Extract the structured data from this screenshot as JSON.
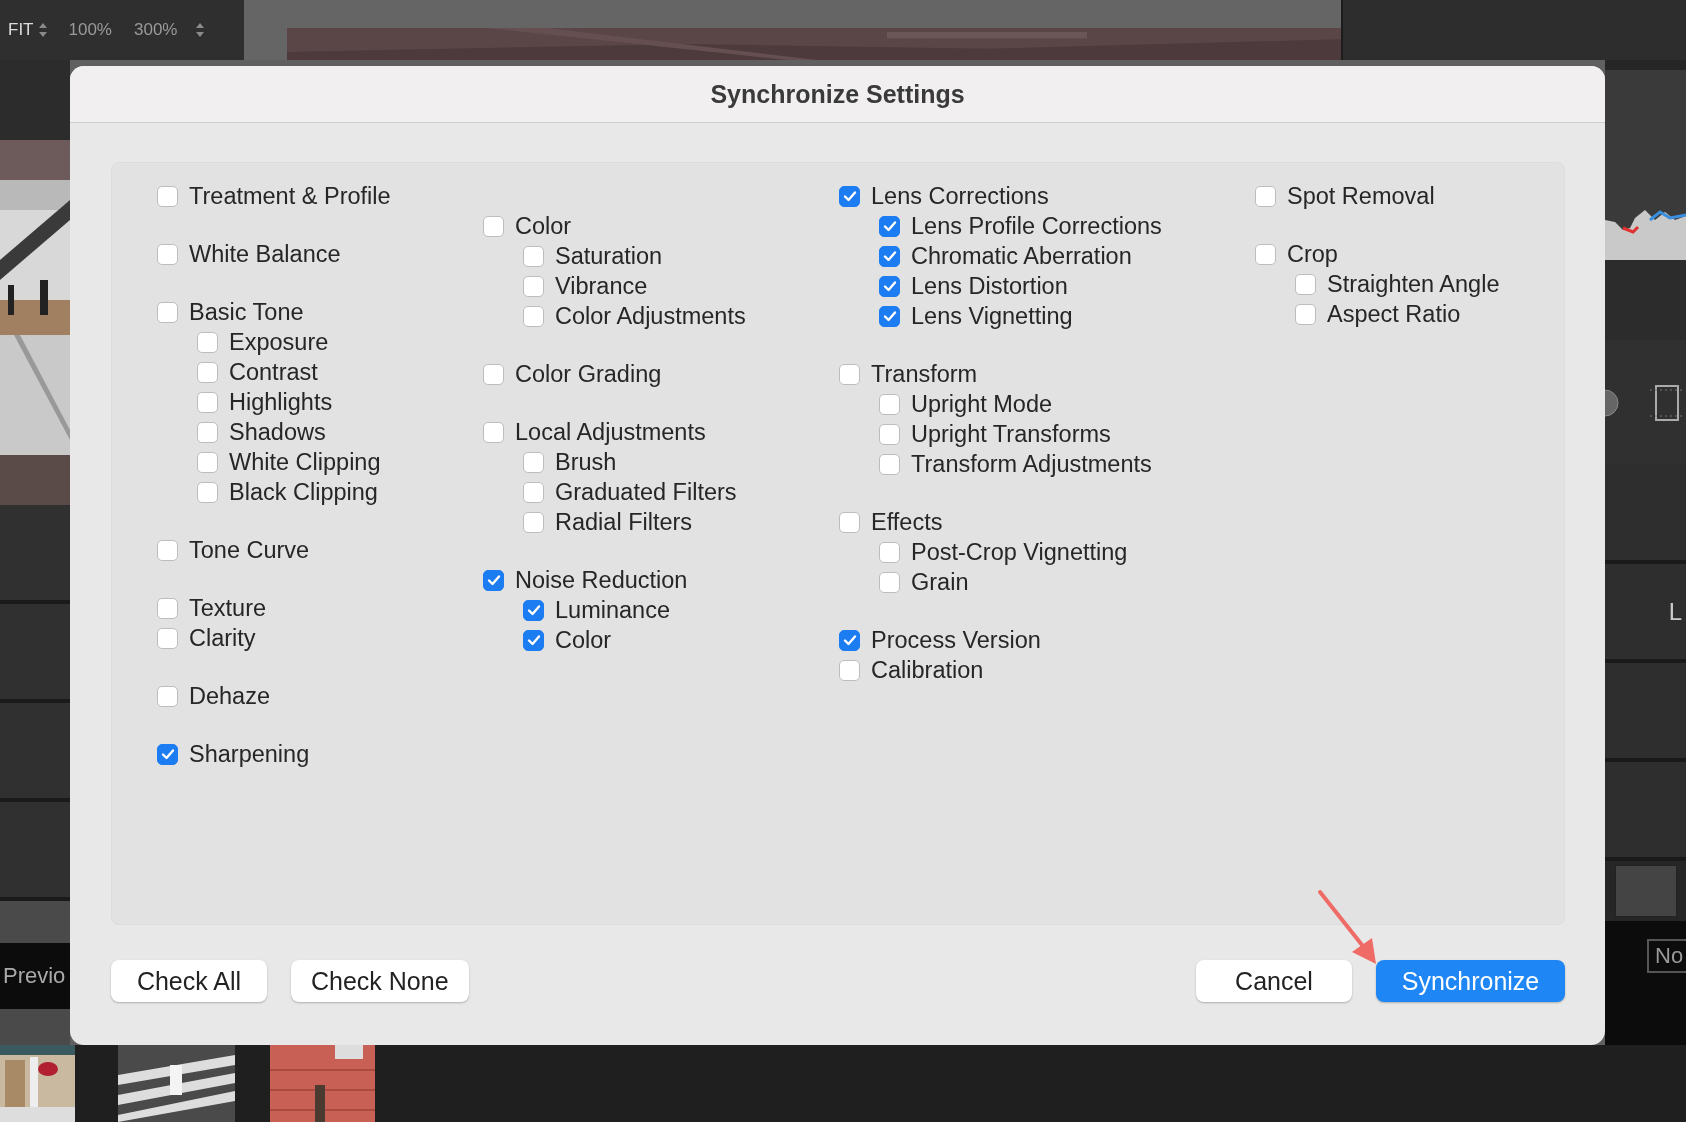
{
  "toolbar": {
    "zoom_options": [
      {
        "label": "FIT",
        "stepper": true
      },
      {
        "label": "100%",
        "stepper": false
      },
      {
        "label": "300%",
        "stepper": true
      }
    ]
  },
  "left_panel": {
    "button_label": "Previo"
  },
  "right_panel": {
    "panel_label": "L",
    "field_value": "No"
  },
  "dialog": {
    "title": "Synchronize Settings",
    "columns": [
      {
        "sections": [
          {
            "items": [
              {
                "label": "Treatment & Profile",
                "checked": false
              }
            ]
          },
          {
            "items": [
              {
                "label": "White Balance",
                "checked": false
              }
            ]
          },
          {
            "items": [
              {
                "label": "Basic Tone",
                "checked": false,
                "children": [
                  {
                    "label": "Exposure",
                    "checked": false
                  },
                  {
                    "label": "Contrast",
                    "checked": false
                  },
                  {
                    "label": "Highlights",
                    "checked": false
                  },
                  {
                    "label": "Shadows",
                    "checked": false
                  },
                  {
                    "label": "White Clipping",
                    "checked": false
                  },
                  {
                    "label": "Black Clipping",
                    "checked": false
                  }
                ]
              }
            ]
          },
          {
            "items": [
              {
                "label": "Tone Curve",
                "checked": false
              }
            ]
          },
          {
            "items": [
              {
                "label": "Texture",
                "checked": false
              },
              {
                "label": "Clarity",
                "checked": false
              }
            ]
          },
          {
            "items": [
              {
                "label": "Dehaze",
                "checked": false
              }
            ]
          },
          {
            "items": [
              {
                "label": "Sharpening",
                "checked": true
              }
            ]
          }
        ]
      },
      {
        "sections": [
          {
            "items": [
              {
                "label": "Color",
                "checked": false,
                "children": [
                  {
                    "label": "Saturation",
                    "checked": false
                  },
                  {
                    "label": "Vibrance",
                    "checked": false
                  },
                  {
                    "label": "Color Adjustments",
                    "checked": false
                  }
                ]
              }
            ]
          },
          {
            "items": [
              {
                "label": "Color Grading",
                "checked": false
              }
            ]
          },
          {
            "items": [
              {
                "label": "Local Adjustments",
                "checked": false,
                "children": [
                  {
                    "label": "Brush",
                    "checked": false
                  },
                  {
                    "label": "Graduated Filters",
                    "checked": false
                  },
                  {
                    "label": "Radial Filters",
                    "checked": false
                  }
                ]
              }
            ]
          },
          {
            "items": [
              {
                "label": "Noise Reduction",
                "checked": true,
                "children": [
                  {
                    "label": "Luminance",
                    "checked": true
                  },
                  {
                    "label": "Color",
                    "checked": true
                  }
                ]
              }
            ]
          }
        ]
      },
      {
        "sections": [
          {
            "items": [
              {
                "label": "Lens Corrections",
                "checked": true,
                "children": [
                  {
                    "label": "Lens Profile Corrections",
                    "checked": true
                  },
                  {
                    "label": "Chromatic Aberration",
                    "checked": true
                  },
                  {
                    "label": "Lens Distortion",
                    "checked": true
                  },
                  {
                    "label": "Lens Vignetting",
                    "checked": true
                  }
                ]
              }
            ]
          },
          {
            "items": [
              {
                "label": "Transform",
                "checked": false,
                "children": [
                  {
                    "label": "Upright Mode",
                    "checked": false
                  },
                  {
                    "label": "Upright Transforms",
                    "checked": false
                  },
                  {
                    "label": "Transform Adjustments",
                    "checked": false
                  }
                ]
              }
            ]
          },
          {
            "items": [
              {
                "label": "Effects",
                "checked": false,
                "children": [
                  {
                    "label": "Post-Crop Vignetting",
                    "checked": false
                  },
                  {
                    "label": "Grain",
                    "checked": false
                  }
                ]
              }
            ]
          },
          {
            "items": [
              {
                "label": "Process Version",
                "checked": true
              },
              {
                "label": "Calibration",
                "checked": false
              }
            ]
          }
        ]
      },
      {
        "sections": [
          {
            "items": [
              {
                "label": "Spot Removal",
                "checked": false
              }
            ]
          },
          {
            "items": [
              {
                "label": "Crop",
                "checked": false,
                "children": [
                  {
                    "label": "Straighten Angle",
                    "checked": false
                  },
                  {
                    "label": "Aspect Ratio",
                    "checked": false
                  }
                ]
              }
            ]
          }
        ]
      }
    ],
    "left_buttons": [
      "Check All",
      "Check None"
    ],
    "right_buttons": [
      {
        "label": "Cancel",
        "kind": "secondary"
      },
      {
        "label": "Synchronize",
        "kind": "primary"
      }
    ]
  }
}
